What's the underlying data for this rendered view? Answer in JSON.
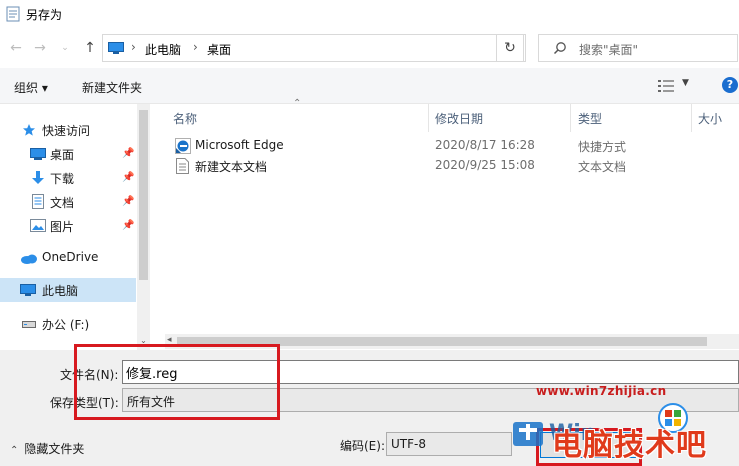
{
  "window": {
    "title": "另存为"
  },
  "address": {
    "crumbs": [
      "此电脑",
      "桌面"
    ]
  },
  "search": {
    "placeholder": "搜索\"桌面\""
  },
  "toolbar": {
    "organize_label": "组织 ▾",
    "new_folder_label": "新建文件夹"
  },
  "navpane": {
    "items": [
      {
        "label": "快速访问",
        "icon": "star-icon"
      },
      {
        "label": "桌面",
        "icon": "desktop-icon",
        "pinned": true
      },
      {
        "label": "下载",
        "icon": "download-icon",
        "pinned": true
      },
      {
        "label": "文档",
        "icon": "document-icon",
        "pinned": true
      },
      {
        "label": "图片",
        "icon": "picture-icon",
        "pinned": true
      },
      {
        "label": "OneDrive",
        "icon": "cloud-icon"
      },
      {
        "label": "此电脑",
        "icon": "computer-icon",
        "selected": true
      },
      {
        "label": "办公 (F:)",
        "icon": "drive-icon"
      }
    ]
  },
  "filelist": {
    "columns": [
      "名称",
      "修改日期",
      "类型",
      "大小"
    ],
    "rows": [
      {
        "name": "Microsoft Edge",
        "date": "2020/8/17 16:28",
        "type": "快捷方式",
        "icon": "edge-shortcut-icon"
      },
      {
        "name": "新建文本文档",
        "date": "2020/9/25 15:08",
        "type": "文本文档",
        "icon": "text-file-icon"
      }
    ]
  },
  "form": {
    "filename_label": "文件名(N):",
    "filename_value": "修复.reg",
    "filetype_label": "保存类型(T):",
    "filetype_value": "所有文件"
  },
  "footer": {
    "hide_folders_label": "隐藏文件夹",
    "encoding_label": "编码(E):",
    "encoding_value": "UTF-8"
  },
  "watermark": {
    "url": "www.win7zhijia.cn",
    "text": "电脑技术吧"
  },
  "colors": {
    "accent": "#0078d7",
    "selection": "#cce4f7",
    "highlight_box": "#d7191f"
  }
}
